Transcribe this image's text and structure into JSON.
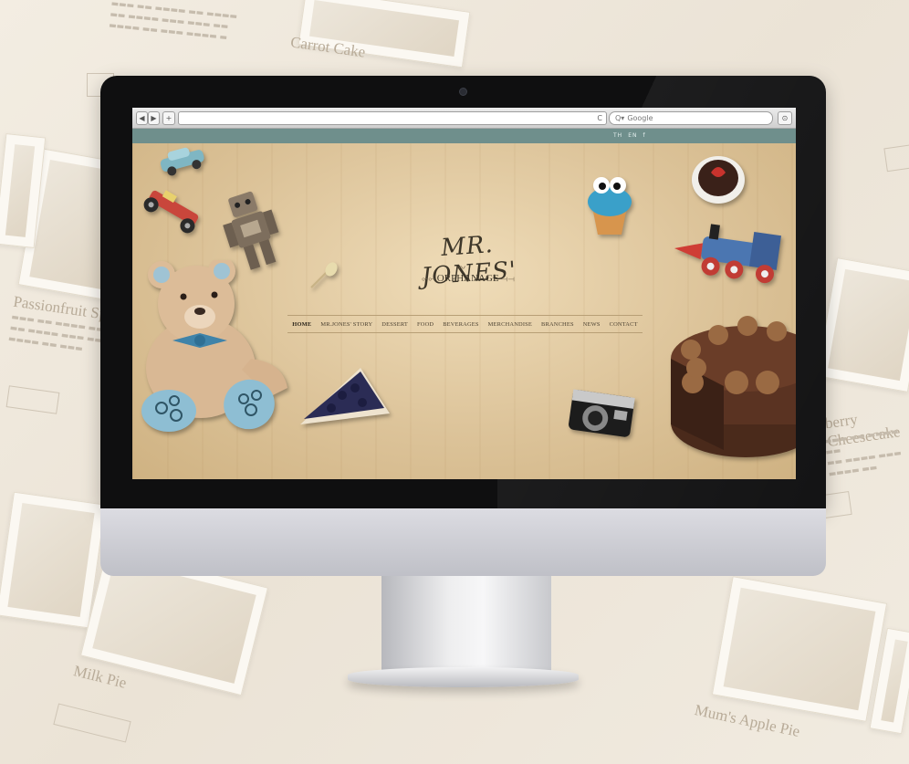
{
  "background": {
    "cards": [
      {
        "title": "Carrot Cake"
      },
      {
        "title": "Passionfruit Sponge"
      },
      {
        "title": "berry Cheesecake"
      },
      {
        "title": "Milk Pie"
      },
      {
        "title": "Mum's Apple Pie"
      }
    ]
  },
  "browser": {
    "back_label": "◀",
    "forward_label": "▶",
    "new_tab_label": "+",
    "reload_label": "C",
    "search_placeholder": "Google",
    "search_icon": "Q▾",
    "download_label": "⊙"
  },
  "site": {
    "languages": [
      "TH",
      "EN"
    ],
    "social_label": "f",
    "logo_main": "MR. JONES'",
    "logo_sub": "ORPHANAGE",
    "nav": [
      {
        "label": "HOME",
        "active": true
      },
      {
        "label": "MR.JONES' STORY",
        "active": false
      },
      {
        "label": "DESSERT",
        "active": false
      },
      {
        "label": "FOOD",
        "active": false
      },
      {
        "label": "BEVERAGES",
        "active": false
      },
      {
        "label": "MERCHANDISE",
        "active": false
      },
      {
        "label": "BRANCHES",
        "active": false
      },
      {
        "label": "NEWS",
        "active": false
      },
      {
        "label": "CONTACT",
        "active": false
      }
    ]
  },
  "colors": {
    "strip": "#6f8f8c",
    "wood": "#dcc399",
    "text": "#3d3629"
  }
}
